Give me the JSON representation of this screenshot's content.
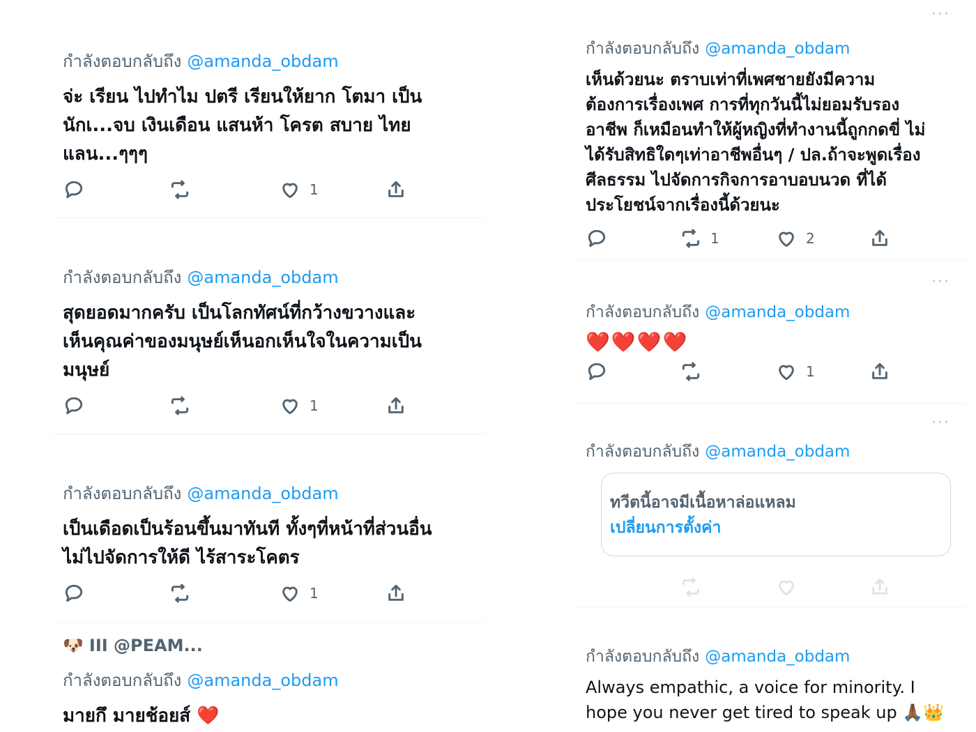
{
  "reply_prefix": "กำลังตอบกลับถึง",
  "reply_handle": "@amanda_obdam",
  "more_icon": "···",
  "left": [
    {
      "text": "จ่ะ เรียน ไปทำไม ปตรี เรียนให้ยาก โตมา เป็น\nนักเ...จบ เงินเดือน แสนห้า โครต สบาย ไทย\nแลน...ๆๆๆ",
      "likes": "1"
    },
    {
      "text": "สุดยอดมากครับ เป็นโลกทัศน์ที่กว้างขวางและ\nเห็นคุณค่าของมนุษย์เห็นอกเห็นใจในความเป็น\nมนุษย์",
      "likes": "1"
    },
    {
      "text": "เป็นเดือดเป็นร้อนขึ้นมาทันที  ทั้งๆที่หน้าที่ส่วนอื่น\nไม่ไปจัดการให้ดี ไร้สาระโคตร",
      "likes": "1"
    },
    {
      "profile": "III @PEAM...",
      "text": "มายกึ มายช้อยส์ ❤️"
    }
  ],
  "right": [
    {
      "text": "เห็นด้วยนะ ตราบเท่าที่เพศชายยังมีความ\nต้องการเรื่องเพศ การที่ทุกวันนี้ไม่ยอมรับรอง\nอาชีพ ก็เหมือนทำให้ผู้หญิงที่ทำงานนี้ถูกกดขี่ ไม่\nได้รับสิทธิใดๆเท่าอาชีพอื่นๆ / ปล.ถ้าจะพูดเรื่อง\nศีลธรรม ไปจัดการกิจการอาบอบนวด ที่ได้\nประโยชน์จากเรื่องนี้ด้วยนะ",
      "retweets": "1",
      "likes": "2"
    },
    {
      "hearts": "❤️❤️❤️❤️",
      "likes": "1"
    },
    {
      "warning": "ทวีตนี้อาจมีเนื้อหาล่อแหลม",
      "change_settings": "เปลี่ยนการตั้งค่า"
    },
    {
      "text": "Always empathic, a voice for minority. I\nhope you never get tired to speak up 🙏🏾👑"
    }
  ],
  "icons": [
    "reply-icon",
    "retweet-icon",
    "like-icon",
    "share-icon",
    "dog-emoji-icon"
  ]
}
